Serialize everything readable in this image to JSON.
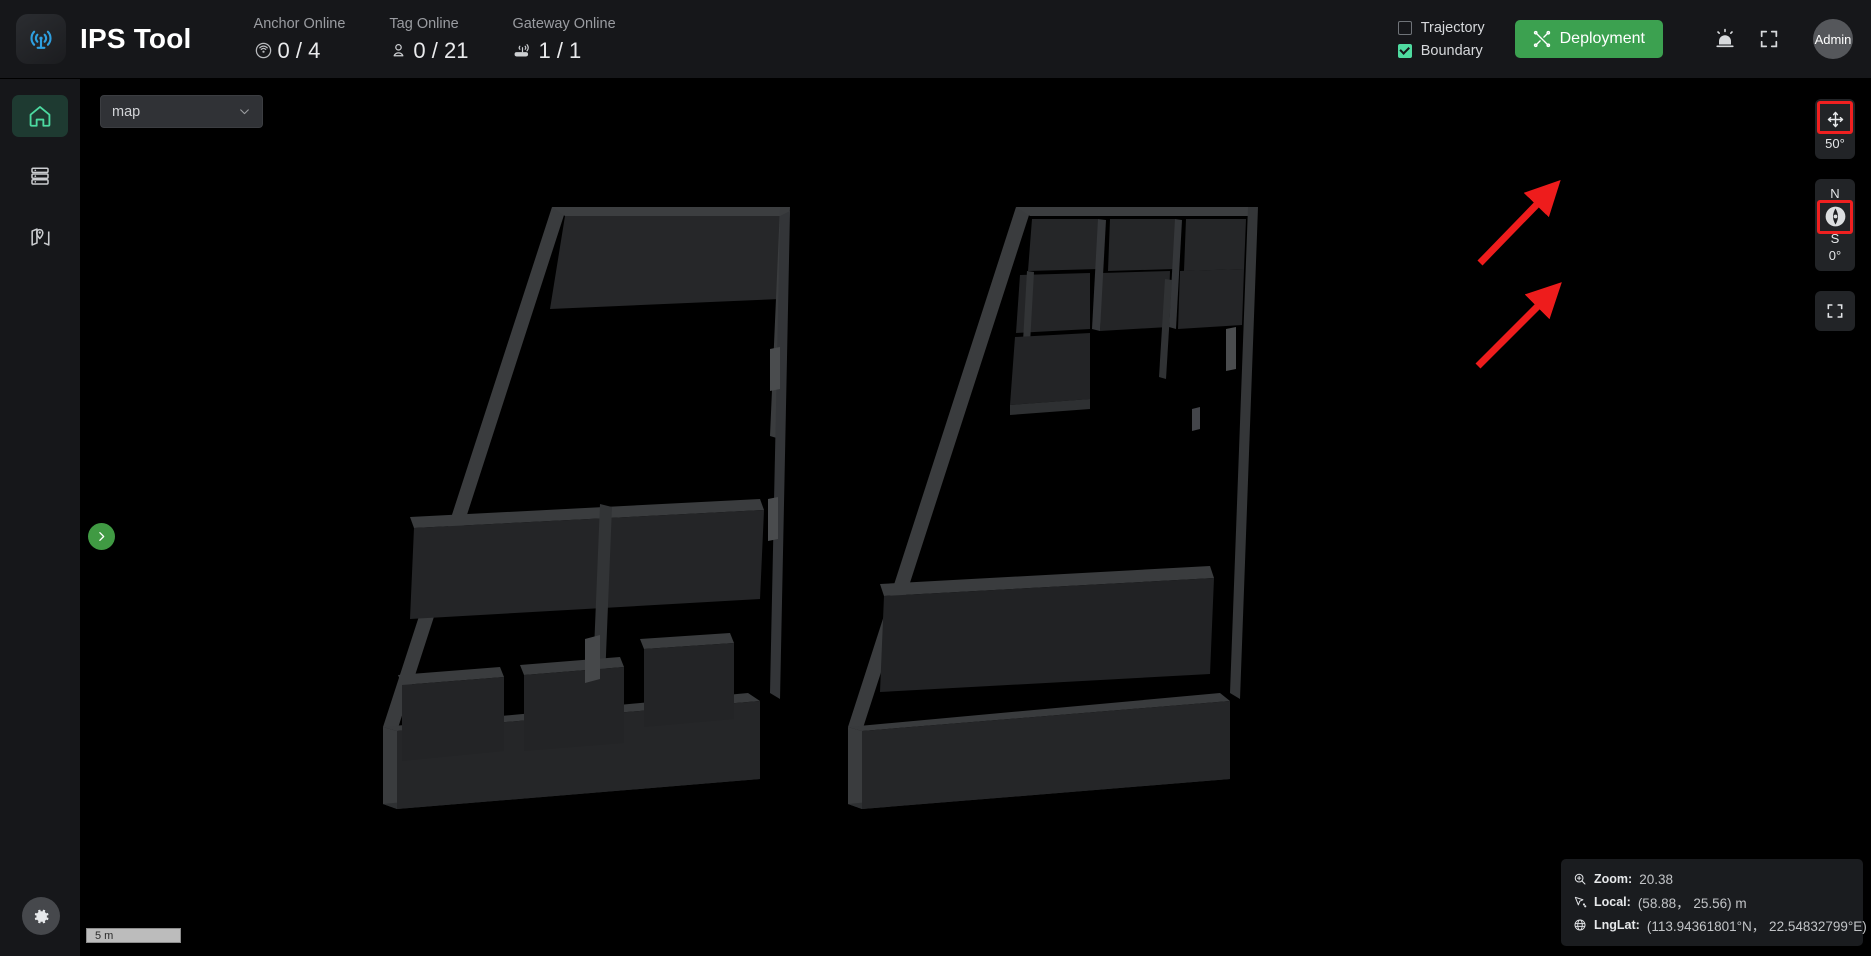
{
  "app": {
    "title": "IPS Tool",
    "logo_icon": "antenna-broadcast-icon"
  },
  "header": {
    "stats": [
      {
        "label": "Anchor Online",
        "value": "0 / 4",
        "icon": "anchor-signal-icon"
      },
      {
        "label": "Tag Online",
        "value": "0 / 21",
        "icon": "tag-pin-icon"
      },
      {
        "label": "Gateway Online",
        "value": "1 / 1",
        "icon": "gateway-router-icon"
      }
    ],
    "checkboxes": [
      {
        "label": "Trajectory",
        "checked": false
      },
      {
        "label": "Boundary",
        "checked": true
      }
    ],
    "deployment_label": "Deployment",
    "deployment_icon": "tools-cross-icon",
    "deployment_color": "#3ca150",
    "alarm_icon": "alarm-siren-icon",
    "fullscreen_icon": "fullscreen-icon",
    "avatar_label": "Admin"
  },
  "sidebar": {
    "items": [
      {
        "name": "home",
        "icon": "home-icon",
        "active": true
      },
      {
        "name": "devices",
        "icon": "server-list-icon",
        "active": false
      },
      {
        "name": "map-location",
        "icon": "map-pin-icon",
        "active": false
      }
    ],
    "settings_icon": "gear-icon"
  },
  "map": {
    "selector_value": "map",
    "selector_icon": "chevron-down-icon",
    "panel_toggle_icon": "chevron-right-icon",
    "panel_toggle_color": "#409a43",
    "scale_label": "5 m"
  },
  "controls": {
    "tilt": {
      "icon": "move-arrows-icon",
      "value": "50°",
      "highlighted": true,
      "highlight_color": "#ef2020"
    },
    "compass": {
      "north_label": "N",
      "south_label": "S",
      "icon": "compass-needle-icon",
      "value": "0°",
      "highlighted": true,
      "highlight_color": "#ef2020"
    },
    "reset_view": {
      "icon": "fullscreen-expand-icon"
    }
  },
  "info_panel": {
    "rows": [
      {
        "icon": "zoom-in-icon",
        "key": "Zoom:",
        "value": "20.38"
      },
      {
        "icon": "cursor-coords-icon",
        "key": "Local:",
        "value": "(58.88， 25.56) m"
      },
      {
        "icon": "globe-icon",
        "key": "LngLat:",
        "value": "(113.94361801°N， 22.54832799°E)"
      }
    ]
  },
  "annotations": {
    "arrows": [
      {
        "name": "arrow-to-tilt-control",
        "color": "#ee1c1c"
      },
      {
        "name": "arrow-to-compass-control",
        "color": "#ee1c1c"
      }
    ]
  }
}
